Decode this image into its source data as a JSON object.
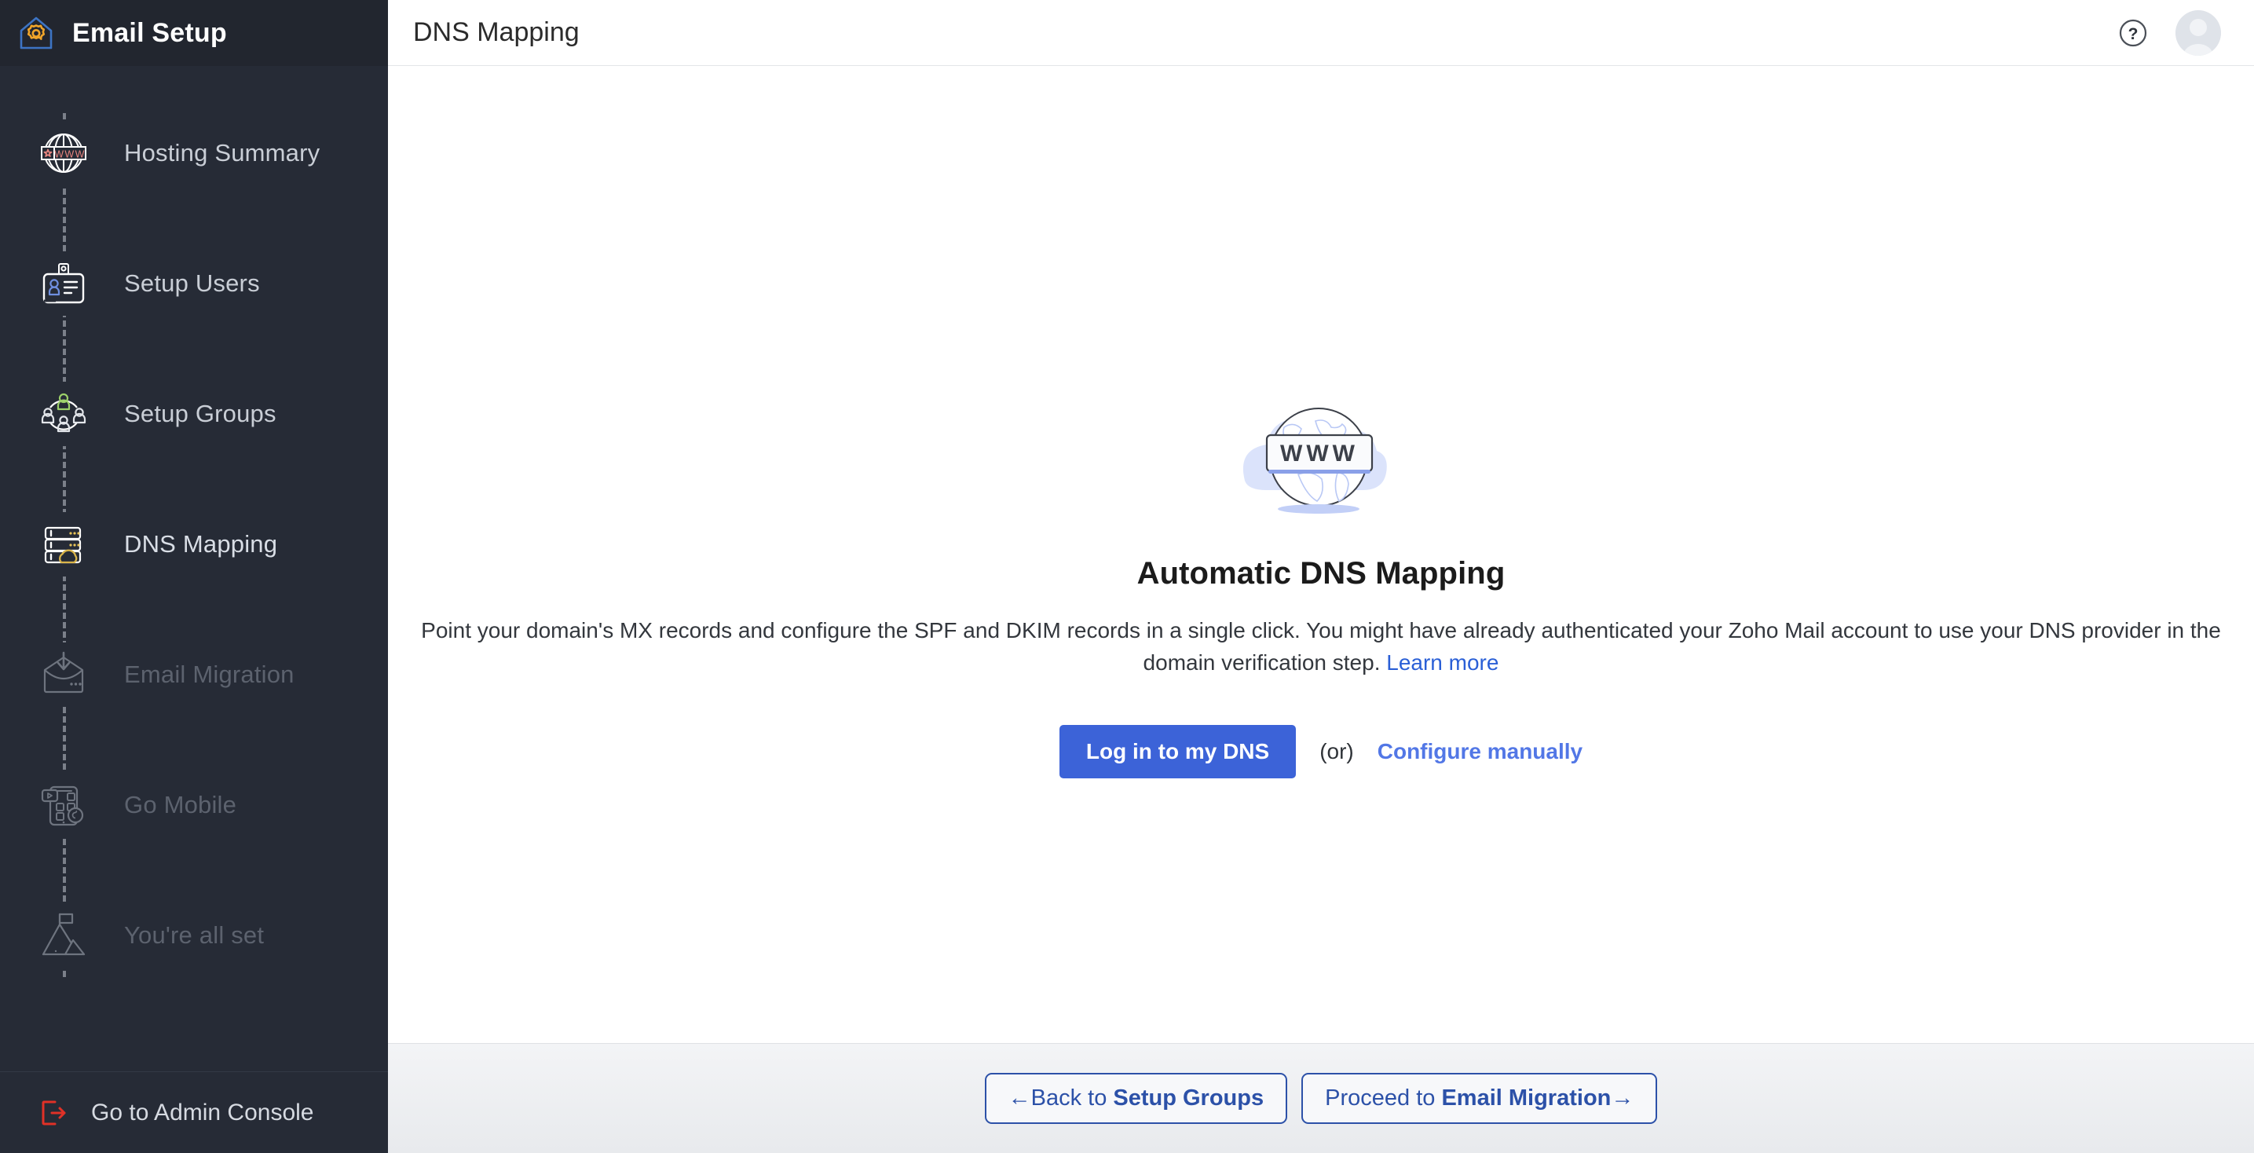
{
  "sidebar": {
    "brand": {
      "title": "Email Setup",
      "logo_icon": "house-gear-icon"
    },
    "items": [
      {
        "label": "Hosting Summary",
        "icon": "globe-www-icon",
        "state": "done"
      },
      {
        "label": "Setup Users",
        "icon": "id-badge-icon",
        "state": "done"
      },
      {
        "label": "Setup Groups",
        "icon": "user-group-network-icon",
        "state": "done"
      },
      {
        "label": "DNS Mapping",
        "icon": "server-cloud-icon",
        "state": "active"
      },
      {
        "label": "Email Migration",
        "icon": "envelope-download-icon",
        "state": "disabled"
      },
      {
        "label": "Go Mobile",
        "icon": "mobile-apps-icon",
        "state": "disabled"
      },
      {
        "label": "You're all set",
        "icon": "mountain-flag-icon",
        "state": "disabled"
      }
    ],
    "footer": {
      "label": "Go to Admin Console",
      "icon": "exit-arrow-icon"
    }
  },
  "header": {
    "title": "DNS Mapping",
    "help_icon": "question-circle-icon",
    "avatar_icon": "user-avatar-icon"
  },
  "main": {
    "illustration_icon": "globe-www-illustration",
    "title": "Automatic DNS Mapping",
    "description": "Point your domain's MX records and configure the SPF and DKIM records in a single click. You might have already authenticated your Zoho Mail account to use your DNS provider in the domain verification step.",
    "learn_more_label": "Learn more",
    "primary_button": "Log in to my DNS",
    "or_label": "(or)",
    "manual_link": "Configure manually"
  },
  "footer": {
    "back_prefix": "Back to ",
    "back_target": "Setup Groups",
    "proceed_prefix": "Proceed to ",
    "proceed_target": "Email Migration",
    "back_arrow": "←",
    "forward_arrow": "→"
  },
  "colors": {
    "sidebar_bg": "#262b36",
    "primary_button": "#3c63d8",
    "link": "#2a5fd6",
    "ghost_border": "#2c51a8",
    "exit_icon": "#e03127",
    "logo_accent": "#f0a52a"
  }
}
